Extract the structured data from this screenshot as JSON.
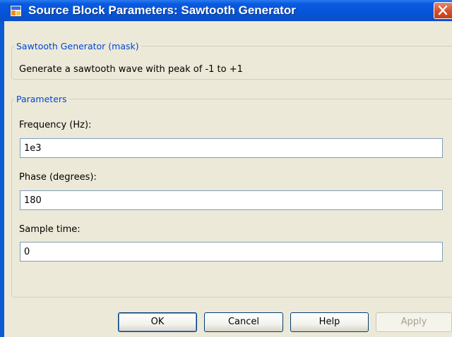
{
  "window": {
    "title": "Source Block Parameters: Sawtooth Generator"
  },
  "mask_group": {
    "legend": "Sawtooth Generator (mask)",
    "description": "Generate a sawtooth wave with peak of -1 to +1"
  },
  "parameters": {
    "legend": "Parameters",
    "fields": [
      {
        "label": "Frequency (Hz):",
        "value": "1e3"
      },
      {
        "label": "Phase (degrees):",
        "value": "180"
      },
      {
        "label": "Sample time:",
        "value": "0"
      }
    ]
  },
  "buttons": {
    "ok": "OK",
    "cancel": "Cancel",
    "help": "Help",
    "apply": "Apply"
  },
  "icons": {
    "app": "simulink-block-icon",
    "close": "close-icon"
  },
  "colors": {
    "titlebar": "#0654d8",
    "legend_text": "#0046d5",
    "dialog_bg": "#ece9d8",
    "close_button": "#d5542e"
  }
}
